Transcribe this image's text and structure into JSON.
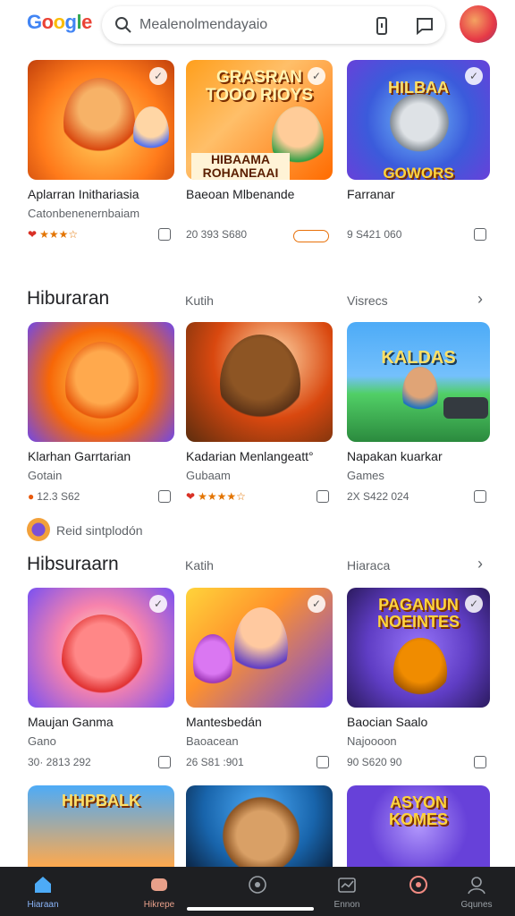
{
  "header": {
    "logo_letters": [
      "G",
      "o",
      "o",
      "g",
      "l",
      "e"
    ],
    "search_text": "Mealenolmendayaio",
    "icons": [
      "search-icon",
      "phone-icon",
      "chat-icon",
      "avatar"
    ]
  },
  "row1": [
    {
      "title": "Aplarran Inithariasia",
      "sub": "Catonbenenernbaiam",
      "meta": "★★★☆",
      "art": "lion"
    },
    {
      "title": "Baeoan Mlbenande",
      "sub": "",
      "meta": "20 393 S680",
      "art": "Grasran Tooo Rioys / Hibaama Rohaneaai"
    },
    {
      "title": "Farranar",
      "sub": "",
      "meta": "9 S421 060",
      "art": "Hilbaa Gowors"
    }
  ],
  "section2": {
    "title": "Hiburaran",
    "mid": "Kutih",
    "right": "Visrecs",
    "chevron": "›"
  },
  "row2": [
    {
      "title": "Klarhan Garrtarian",
      "sub": "Gotain",
      "meta": "12.3 S62",
      "art": "bear"
    },
    {
      "title": "Kadarian Menlangeatt°",
      "sub": "Gubaam",
      "meta": "★★★★☆",
      "art": "brown-bear"
    },
    {
      "title": "Napakan kuarkar",
      "sub": "Games",
      "meta": "2X S422 024",
      "art": "Kaldas"
    }
  ],
  "sponsor": {
    "text": "Reid sintplodón"
  },
  "section3": {
    "title": "Hibsuraarn",
    "mid": "Katih",
    "right": "Hiaraca",
    "chevron": "›"
  },
  "row3": [
    {
      "title": "Maujan Ganma",
      "sub": "Gano",
      "meta": "30· 2813 292",
      "art": "red-bear"
    },
    {
      "title": "Mantesbedán",
      "sub": "Baoacean",
      "meta": "26 S81 :901",
      "art": "kids"
    },
    {
      "title": "Baocian Saalo",
      "sub": "Najoooon",
      "meta": "90 S620 90",
      "art": "Paganun Noeintes"
    }
  ],
  "row4": [
    {
      "art": "Hhpbalk"
    },
    {
      "art": "bear-face"
    },
    {
      "art": "Asyon Komes"
    }
  ],
  "bottom_nav": [
    {
      "label": "Hiaraan",
      "icon": "home-icon"
    },
    {
      "label": "Hikrepe",
      "icon": "apps-icon"
    },
    {
      "label": "",
      "icon": "compass-icon"
    },
    {
      "label": "Ennon",
      "icon": "inbox-icon"
    },
    {
      "label": "",
      "icon": "notification-icon"
    },
    {
      "label": "Gqunes",
      "icon": "account-icon"
    }
  ],
  "colors": {
    "accent": "#e8710a",
    "nav_bg": "#1e1f22",
    "stars": "#e37400",
    "heart": "#d93025"
  }
}
